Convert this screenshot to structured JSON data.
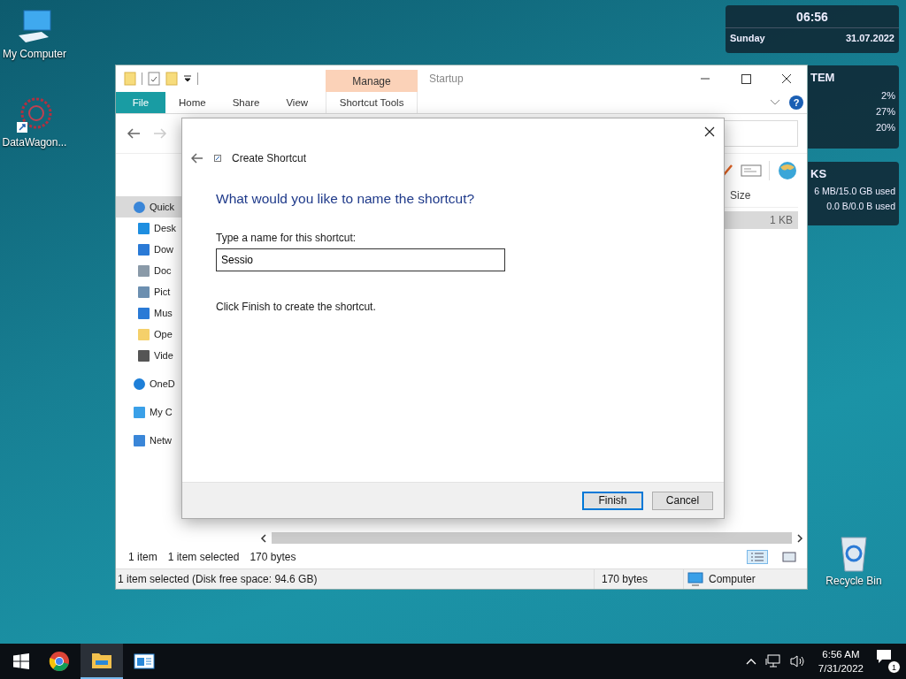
{
  "desktop_icons": [
    {
      "label": "My Computer",
      "kind": "computer"
    },
    {
      "label": "DataWagon...",
      "kind": "app"
    },
    {
      "label": "Recycle Bin",
      "kind": "recycle"
    }
  ],
  "widgets": {
    "clock": {
      "time": "06:56",
      "day": "Sunday",
      "date": "31.07.2022"
    },
    "system": {
      "title": "TEM",
      "readings": [
        "2%",
        "27%",
        "20%"
      ]
    },
    "disks": {
      "title": "KS",
      "readings": [
        "6 MB/15.0 GB used",
        "0.0 B/0.0 B used"
      ]
    }
  },
  "explorer": {
    "window_title": "Startup",
    "context_tab": {
      "group": "Manage",
      "label": "Shortcut Tools"
    },
    "ribbon_tabs": [
      {
        "label": "File",
        "kind": "file"
      },
      {
        "label": "Home",
        "kind": "tab"
      },
      {
        "label": "Share",
        "kind": "tab"
      },
      {
        "label": "View",
        "kind": "tab"
      }
    ],
    "help_label": "?",
    "nav_items": [
      {
        "label": "Quick",
        "kind": "star",
        "selected": true,
        "children": [
          {
            "label": "Desk",
            "kind": "desktop",
            "selected": false
          },
          {
            "label": "Dow",
            "kind": "download",
            "selected": false
          },
          {
            "label": "Doc",
            "kind": "document",
            "selected": false
          },
          {
            "label": "Pict",
            "kind": "pictures",
            "selected": false
          },
          {
            "label": "Mus",
            "kind": "music",
            "selected": false
          },
          {
            "label": "Ope",
            "kind": "folder",
            "selected": false
          },
          {
            "label": "Vide",
            "kind": "video",
            "selected": false
          }
        ]
      },
      {
        "label": "OneD",
        "kind": "cloud",
        "selected": false
      },
      {
        "label": "My C",
        "kind": "computer",
        "selected": false
      },
      {
        "label": "Netw",
        "kind": "network",
        "selected": false
      }
    ],
    "columns": [
      "Size"
    ],
    "rows": [
      {
        "size": "1 KB",
        "selected": true
      }
    ],
    "status": {
      "count": "1 item",
      "selection": "1 item selected",
      "size": "170 bytes"
    },
    "view_buttons": [
      {
        "kind": "details",
        "selected": true
      },
      {
        "kind": "tiles",
        "selected": false
      }
    ],
    "status_bar": {
      "text": "1 item selected (Disk free space: 94.6 GB)",
      "size": "170 bytes",
      "location": "Computer"
    }
  },
  "dialog": {
    "title": "Create Shortcut",
    "heading": "What would you like to name the shortcut?",
    "field_label": "Type a name for this shortcut:",
    "value": "Sessio",
    "instruction": "Click Finish to create the shortcut.",
    "buttons": [
      {
        "label": "Finish",
        "default": true
      },
      {
        "label": "Cancel",
        "default": false
      }
    ]
  },
  "taskbar": {
    "apps": [
      {
        "kind": "chrome",
        "active": false
      },
      {
        "kind": "explorer",
        "active": true
      },
      {
        "kind": "window",
        "active": false
      }
    ],
    "time": "6:56 AM",
    "date": "7/31/2022",
    "notification_count": "1"
  }
}
